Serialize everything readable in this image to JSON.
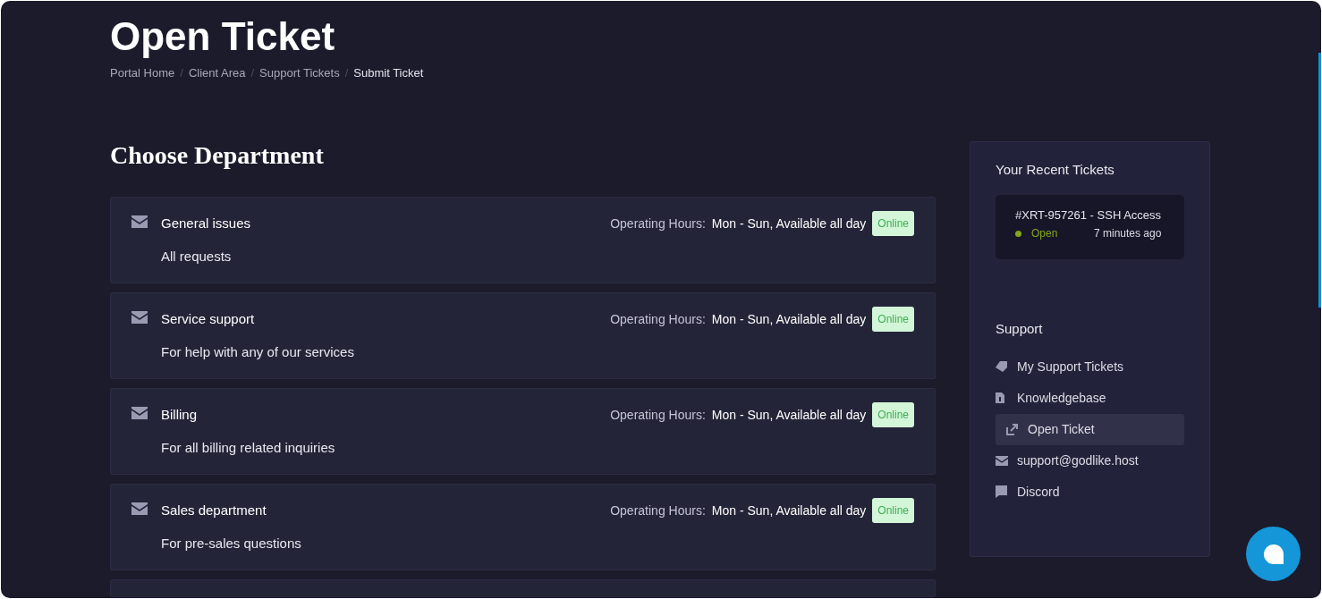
{
  "page_title": "Open Ticket",
  "breadcrumb_separator": "/",
  "breadcrumb": [
    {
      "label": "Portal Home",
      "current": false
    },
    {
      "label": "Client Area",
      "current": false
    },
    {
      "label": "Support Tickets",
      "current": false
    },
    {
      "label": "Submit Ticket",
      "current": true
    }
  ],
  "section_title": "Choose Department",
  "departments": [
    {
      "name": "General issues",
      "description": "All requests",
      "hours_label": "Operating Hours:",
      "hours": "Mon - Sun, Available all day",
      "status": "Online"
    },
    {
      "name": "Service support",
      "description": "For help with any of our services",
      "hours_label": "Operating Hours:",
      "hours": "Mon - Sun, Available all day",
      "status": "Online"
    },
    {
      "name": "Billing",
      "description": "For all billing related inquiries",
      "hours_label": "Operating Hours:",
      "hours": "Mon - Sun, Available all day",
      "status": "Online"
    },
    {
      "name": "Sales department",
      "description": "For pre-sales questions",
      "hours_label": "Operating Hours:",
      "hours": "Mon - Sun, Available all day",
      "status": "Online"
    }
  ],
  "recent_tickets": {
    "title": "Your Recent Tickets",
    "items": [
      {
        "subject": "#XRT-957261 - SSH Access",
        "status": "Open",
        "color": "#84a51c",
        "time": "7 minutes ago"
      }
    ]
  },
  "support": {
    "title": "Support",
    "items": [
      {
        "label": "My Support Tickets",
        "selected": false
      },
      {
        "label": "Knowledgebase",
        "selected": false
      },
      {
        "label": "Open Ticket",
        "selected": true
      },
      {
        "label": "support@godlike.host",
        "selected": false
      },
      {
        "label": "Discord",
        "selected": false
      }
    ]
  }
}
